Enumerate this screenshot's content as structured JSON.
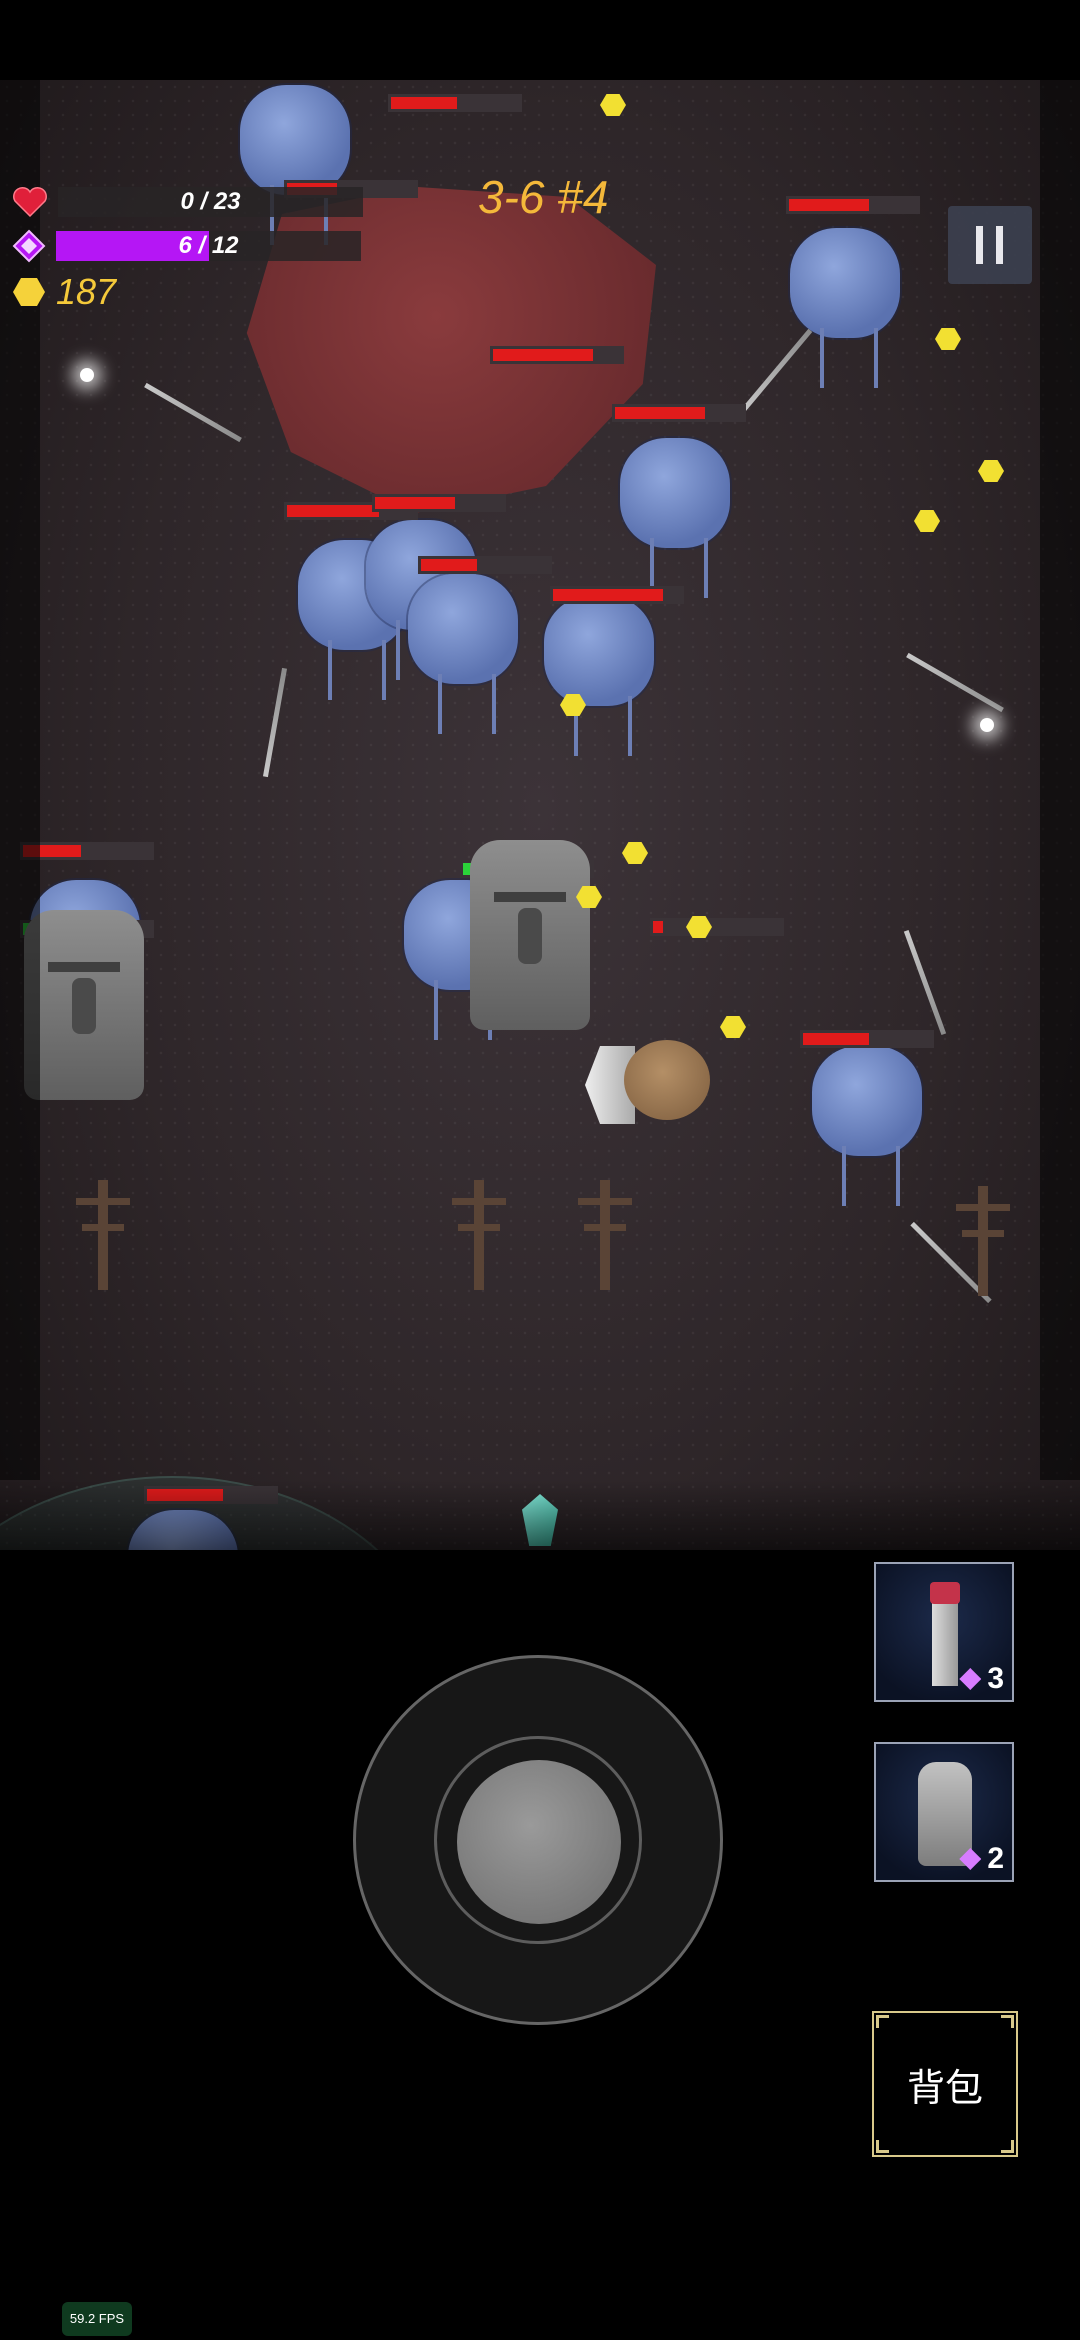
{
  "hud": {
    "health_text": "0 / 23",
    "health_fraction": 0.0,
    "mana_text": "6 / 12",
    "mana_fraction": 0.5,
    "gold": "187",
    "level_label": "3-6 #4"
  },
  "skills": [
    {
      "icon": "beacon-tower-icon",
      "cost": "3"
    },
    {
      "icon": "moai-statue-icon",
      "cost": "2"
    }
  ],
  "buttons": {
    "bag_label": "背包",
    "pause_icon": "pause-icon"
  },
  "fps_label": "59.2 FPS",
  "colors": {
    "health": "#e0203a",
    "mana": "#b516f5",
    "gold": "#f5c93a",
    "level": "#f4b83a",
    "ally_hp": "#2bd43a",
    "enemy_hp": "#e11b1b"
  }
}
